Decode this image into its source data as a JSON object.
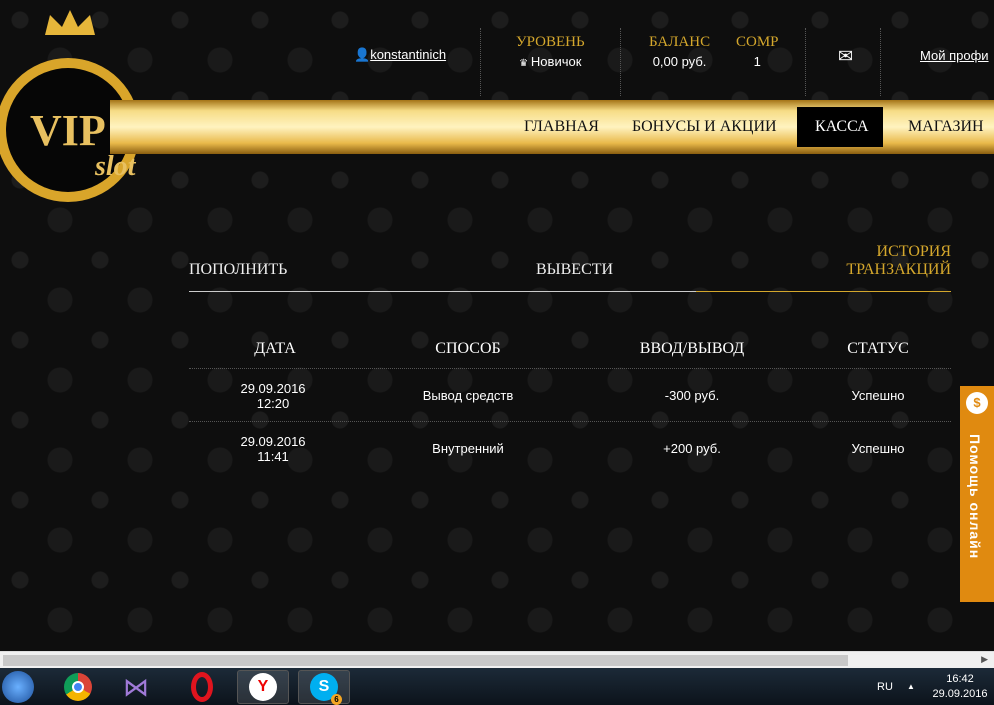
{
  "header": {
    "username": "konstantinich",
    "level_label": "УРОВЕНЬ",
    "level_value": "Новичок",
    "balance_label": "БАЛАНС",
    "balance_value": "0,00 руб.",
    "comp_label": "COMP",
    "comp_value": "1",
    "profile": "Мой профи"
  },
  "logo": {
    "text": "VIP slot"
  },
  "nav": [
    "ГЛАВНАЯ",
    "БОНУСЫ И АКЦИИ",
    "КАССА",
    "МАГАЗИН"
  ],
  "tabs": {
    "deposit": "ПОПОЛНИТЬ",
    "withdraw": "ВЫВЕСТИ",
    "history1": "ИСТОРИЯ",
    "history2": "ТРАНЗАКЦИЙ"
  },
  "table": {
    "headers": [
      "ДАТА",
      "СПОСОБ",
      "ВВОД/ВЫВОД",
      "СТАТУС"
    ],
    "rows": [
      {
        "date": "29.09.2016",
        "time": "12:20",
        "method": "Вывод средств",
        "amount": "-300 руб.",
        "status": "Успешно"
      },
      {
        "date": "29.09.2016",
        "time": "11:41",
        "method": "Внутренний",
        "amount": "+200 руб.",
        "status": "Успешно"
      }
    ]
  },
  "help": {
    "label": "Помощь онлайн"
  },
  "taskbar": {
    "lang": "RU",
    "time": "16:42",
    "date": "29.09.2016",
    "skype_badge": "6"
  }
}
